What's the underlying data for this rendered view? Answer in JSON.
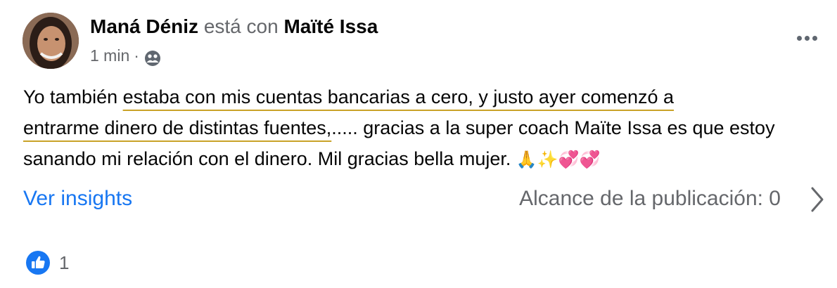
{
  "post": {
    "author_name": "Maná Déniz",
    "connector": "está con",
    "tagged_name": "Maïté Issa",
    "time": "1 min",
    "dot": "·",
    "audience_icon": "friends-icon",
    "text_lead": "Yo también ",
    "text_highlight_1": "estaba con mis cuentas bancarias a cero, y justo ayer comenzó a",
    "text_highlight_2": "entrarme dinero de distintas fuentes,",
    "text_rest": "..... gracias a la super coach Maïte Issa es que estoy sanando mi relación con el dinero. Mil gracias bella mujer. ",
    "emojis": "🙏✨💞💞"
  },
  "insights_label": "Ver insights",
  "reach_label": "Alcance de la publicación: 0",
  "reactions": {
    "icon": "like-icon",
    "count": "1"
  },
  "colors": {
    "link": "#1877f2",
    "muted": "#65676b",
    "underline": "#c9a227"
  }
}
